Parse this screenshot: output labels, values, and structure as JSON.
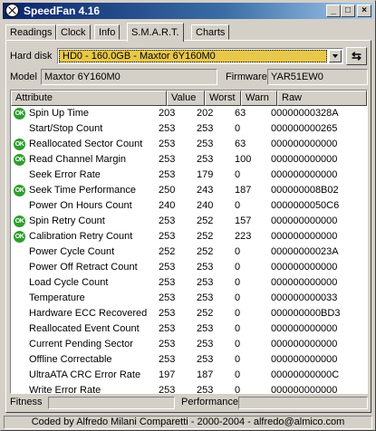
{
  "window": {
    "title": "SpeedFan 4.16",
    "controls": {
      "minimize": "_",
      "maximize": "□",
      "close": "×"
    }
  },
  "tabs": [
    {
      "label": "Readings",
      "active": false
    },
    {
      "label": "Clock",
      "active": false
    },
    {
      "label": "Info",
      "active": false
    },
    {
      "label": "S.M.A.R.T.",
      "active": true
    },
    {
      "label": "Charts",
      "active": false
    }
  ],
  "hard_disk": {
    "label": "Hard disk",
    "selected": "HD0 - 160.0GB - Maxtor 6Y160M0",
    "refresh_icon": "refresh-icon"
  },
  "model": {
    "label": "Model",
    "value": "Maxtor 6Y160M0"
  },
  "firmware": {
    "label": "Firmware",
    "value": "YAR51EW0"
  },
  "table": {
    "headers": [
      "Attribute",
      "Value",
      "Worst",
      "Warn",
      "Raw"
    ],
    "rows": [
      {
        "ok": true,
        "attribute": "Spin Up Time",
        "value": "203",
        "worst": "202",
        "warn": "63",
        "raw": "00000000328A"
      },
      {
        "ok": false,
        "attribute": "Start/Stop Count",
        "value": "253",
        "worst": "253",
        "warn": "0",
        "raw": "000000000265"
      },
      {
        "ok": true,
        "attribute": "Reallocated Sector Count",
        "value": "253",
        "worst": "253",
        "warn": "63",
        "raw": "000000000000"
      },
      {
        "ok": true,
        "attribute": "Read Channel Margin",
        "value": "253",
        "worst": "253",
        "warn": "100",
        "raw": "000000000000"
      },
      {
        "ok": false,
        "attribute": "Seek Error Rate",
        "value": "253",
        "worst": "179",
        "warn": "0",
        "raw": "000000000000"
      },
      {
        "ok": true,
        "attribute": "Seek Time Performance",
        "value": "250",
        "worst": "243",
        "warn": "187",
        "raw": "000000008B02"
      },
      {
        "ok": false,
        "attribute": "Power On Hours Count",
        "value": "240",
        "worst": "240",
        "warn": "0",
        "raw": "0000000050C6"
      },
      {
        "ok": true,
        "attribute": "Spin Retry Count",
        "value": "253",
        "worst": "252",
        "warn": "157",
        "raw": "000000000000"
      },
      {
        "ok": true,
        "attribute": "Calibration Retry Count",
        "value": "253",
        "worst": "252",
        "warn": "223",
        "raw": "000000000000"
      },
      {
        "ok": false,
        "attribute": "Power Cycle Count",
        "value": "252",
        "worst": "252",
        "warn": "0",
        "raw": "00000000023A"
      },
      {
        "ok": false,
        "attribute": "Power Off Retract Count",
        "value": "253",
        "worst": "253",
        "warn": "0",
        "raw": "000000000000"
      },
      {
        "ok": false,
        "attribute": "Load Cycle Count",
        "value": "253",
        "worst": "253",
        "warn": "0",
        "raw": "000000000000"
      },
      {
        "ok": false,
        "attribute": "Temperature",
        "value": "253",
        "worst": "253",
        "warn": "0",
        "raw": "000000000033"
      },
      {
        "ok": false,
        "attribute": "Hardware ECC Recovered",
        "value": "253",
        "worst": "252",
        "warn": "0",
        "raw": "000000000BD3"
      },
      {
        "ok": false,
        "attribute": "Reallocated Event Count",
        "value": "253",
        "worst": "253",
        "warn": "0",
        "raw": "000000000000"
      },
      {
        "ok": false,
        "attribute": "Current Pending Sector",
        "value": "253",
        "worst": "253",
        "warn": "0",
        "raw": "000000000000"
      },
      {
        "ok": false,
        "attribute": "Offline Correctable",
        "value": "253",
        "worst": "253",
        "warn": "0",
        "raw": "000000000000"
      },
      {
        "ok": false,
        "attribute": "UltraATA CRC Error Rate",
        "value": "197",
        "worst": "187",
        "warn": "0",
        "raw": "00000000000C"
      },
      {
        "ok": false,
        "attribute": "Write Error Rate",
        "value": "253",
        "worst": "253",
        "warn": "0",
        "raw": "000000000000"
      }
    ],
    "ok_badge": "OK"
  },
  "footer": {
    "fitness_label": "Fitness",
    "performance_label": "Performance"
  },
  "statusbar": {
    "text": "Coded by Alfredo Milani Comparetti - 2000-2004 - alfredo@almico.com"
  },
  "colors": {
    "title_gradient_start": "#0a246a",
    "dropdown_highlight": "#e8c84a",
    "ok_icon": "#2e9e2e"
  }
}
